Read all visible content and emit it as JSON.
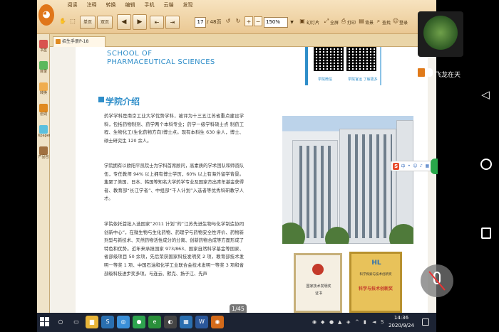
{
  "menu": [
    "阅读",
    "注释",
    "转换",
    "编辑",
    "手机",
    "云端",
    "发现"
  ],
  "toolbar": {
    "single_page": "单页",
    "double_page": "双页",
    "page_current": "17",
    "page_total": "/ 48页",
    "zoom": "150%",
    "slideshow": "幻灯片",
    "fullscreen": "全屏",
    "print": "打印",
    "background": "背景",
    "search": "查找",
    "login": "登录"
  },
  "sidebar": [
    {
      "label": "书签",
      "color": "#d9534f"
    },
    {
      "label": "目录",
      "color": "#5cb85c"
    },
    {
      "label": "转换",
      "color": "#f0ad4e"
    },
    {
      "label": "划词",
      "color": "#e08a20"
    },
    {
      "label": "Xpaper",
      "color": "#5bc0de"
    },
    {
      "label": "产品包",
      "color": "#a07040"
    }
  ],
  "tab": {
    "title": "招生手册P-18"
  },
  "document": {
    "school_en_line1": "SCHOOL OF",
    "school_en_line2": "PHARMACEUTICAL SCIENCES",
    "qr_captions": [
      "学院微信",
      "学院官运 了解更多"
    ],
    "section_title": "学院介绍",
    "paragraphs": [
      "药学学科是南京工业大学优势学科，被评为十三五江苏省重点建设学科，包括药物制剂、药学两个本科专业；药学一级学科硕士点 制药工程、生物化工(生化药物方向)博士点。现有本科生 630 余人，博士、硕士研究生 120 余人。",
      "学院拥有以欧阳平凯院士为学科首席顾问，高素质的学术团队和师资队伍，专任教师 94% 以上拥有博士学历，60% 以上有海外留学背景。集聚了美国、日本、韩国等知名大学药学专业及国家杰出青年基金获得者、教育部“长江学者”、中组部“千人计划”入选者等优秀科研教学人才。",
      "学院依托首批入选国家“2011 计划”的“江苏先进生物与化学制造协同创新中心”，在微生物与生化药物、药理学与药物安全性评价、药物新剂型与新技术、天然药物活性成分的分离、创新药物合成等方面形成了特色和优势。近年来承担国家 973/863、国家自然科学基金等国家、省部级项目 50 余项，先后荣获国家科技发明奖 2 项，教育部技术发明一等奖 1 项、中国石油和化学工业联合会技术发明一等奖 3 项和省部级科技进步奖多项。与连云、默克、扬子江、先声"
    ],
    "cert_left_line1": "国家技术发明奖",
    "cert_left_line2": "证书",
    "cert_right_logo": "HL",
    "cert_right_line1": "科学探索与技术创新奖",
    "cert_right_line2": "科学与技术创新奖"
  },
  "overlay": {
    "page_counter": "1/45",
    "caller_name": "飞龙在天"
  },
  "taskbar": {
    "time": "14:36",
    "date": "2020/9/24",
    "icons": [
      {
        "name": "search",
        "glyph": "○",
        "color": "#1c2333"
      },
      {
        "name": "task-view",
        "glyph": "▭",
        "color": "#1c2333"
      },
      {
        "name": "file-explorer",
        "glyph": "▆",
        "color": "#e8b53a"
      },
      {
        "name": "app-s",
        "glyph": "S",
        "color": "#2a6fb0"
      },
      {
        "name": "app-swirl",
        "glyph": "◎",
        "color": "#3a8fd8"
      },
      {
        "name": "app-green",
        "glyph": "●",
        "color": "#2ea44f"
      },
      {
        "name": "app-e",
        "glyph": "e",
        "color": "#2a8f3a"
      },
      {
        "name": "app-dark",
        "glyph": "◐",
        "color": "#444"
      },
      {
        "name": "app-chart",
        "glyph": "▦",
        "color": "#2a6fb0"
      },
      {
        "name": "app-word",
        "glyph": "W",
        "color": "#2b579a"
      },
      {
        "name": "app-reader",
        "glyph": "◉",
        "color": "#d36a1a"
      }
    ]
  }
}
